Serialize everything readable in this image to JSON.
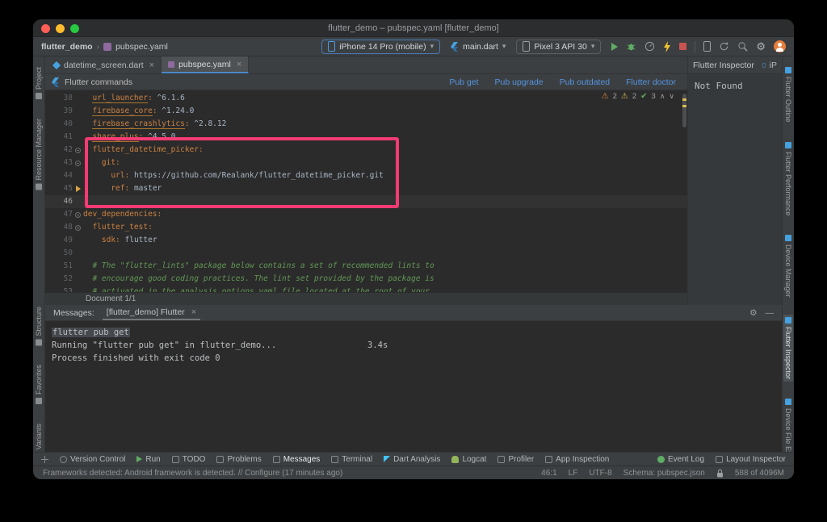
{
  "window": {
    "title": "flutter_demo – pubspec.yaml [flutter_demo]"
  },
  "nav": {
    "project": "flutter_demo",
    "file": "pubspec.yaml",
    "device": "iPhone 14 Pro (mobile)",
    "config": "main.dart",
    "target": "Pixel 3 API 30"
  },
  "tabs": [
    {
      "label": "datetime_screen.dart",
      "type": "dart",
      "active": false
    },
    {
      "label": "pubspec.yaml",
      "type": "yaml",
      "active": true
    }
  ],
  "flutter_bar": {
    "title": "Flutter commands",
    "links": [
      "Pub get",
      "Pub upgrade",
      "Pub outdated",
      "Flutter doctor"
    ]
  },
  "inspections": {
    "errors": "2",
    "warnings": "2",
    "ok": "3"
  },
  "editor": {
    "current_line": "46",
    "document_indicator": "Document 1/1",
    "lines": [
      {
        "num": "38",
        "fold": "",
        "seg": [
          [
            "  ",
            ""
          ],
          [
            "url_launcher",
            "k u"
          ],
          [
            ":",
            "k"
          ],
          [
            " ^6.1.6",
            "v"
          ]
        ]
      },
      {
        "num": "39",
        "fold": "",
        "seg": [
          [
            "  ",
            ""
          ],
          [
            "firebase_core",
            "k u"
          ],
          [
            ":",
            "k"
          ],
          [
            " ^1.24.0",
            "v"
          ]
        ]
      },
      {
        "num": "40",
        "fold": "",
        "seg": [
          [
            "  ",
            ""
          ],
          [
            "firebase_crashlytics",
            "k u"
          ],
          [
            ":",
            "k"
          ],
          [
            " ^2.8.12",
            "v"
          ]
        ]
      },
      {
        "num": "41",
        "fold": "",
        "seg": [
          [
            "  ",
            ""
          ],
          [
            "share_plus",
            "k u"
          ],
          [
            ":",
            "k"
          ],
          [
            " ^4.5.0",
            "v"
          ]
        ]
      },
      {
        "num": "42",
        "fold": "dot",
        "seg": [
          [
            "  ",
            ""
          ],
          [
            "flutter_datetime_picker:",
            "k"
          ]
        ]
      },
      {
        "num": "43",
        "fold": "dot",
        "seg": [
          [
            "    ",
            ""
          ],
          [
            "git:",
            "k"
          ]
        ]
      },
      {
        "num": "44",
        "fold": "",
        "seg": [
          [
            "      ",
            ""
          ],
          [
            "url:",
            "k"
          ],
          [
            " https://github.com/Realank/flutter_datetime_picker.git",
            "v"
          ]
        ]
      },
      {
        "num": "45",
        "fold": "arrow",
        "seg": [
          [
            "      ",
            ""
          ],
          [
            "ref:",
            "k"
          ],
          [
            " master",
            "v"
          ]
        ]
      },
      {
        "num": "46",
        "fold": "",
        "seg": []
      },
      {
        "num": "47",
        "fold": "dot",
        "seg": [
          [
            "dev_dependencies:",
            "k"
          ]
        ]
      },
      {
        "num": "48",
        "fold": "dot",
        "seg": [
          [
            "  ",
            ""
          ],
          [
            "flutter_test:",
            "k"
          ]
        ]
      },
      {
        "num": "49",
        "fold": "",
        "seg": [
          [
            "    ",
            ""
          ],
          [
            "sdk:",
            "k"
          ],
          [
            " flutter",
            "v"
          ]
        ]
      },
      {
        "num": "50",
        "fold": "",
        "seg": []
      },
      {
        "num": "51",
        "fold": "",
        "seg": [
          [
            "  ",
            ""
          ],
          [
            "# The \"flutter_lints\" package below contains a set of recommended lints to",
            "cm"
          ]
        ]
      },
      {
        "num": "52",
        "fold": "",
        "seg": [
          [
            "  ",
            ""
          ],
          [
            "# encourage good coding practices. The lint set provided by the package is",
            "cm"
          ]
        ]
      },
      {
        "num": "53",
        "fold": "",
        "seg": [
          [
            "  ",
            ""
          ],
          [
            "# activated in the analysis_options.yaml file located at the root of your",
            "cm"
          ]
        ]
      }
    ]
  },
  "annotation": {
    "color": "#f43b73"
  },
  "right_panel": {
    "title": "Flutter Inspector",
    "device": "iP",
    "content": "Not Found"
  },
  "right_strip": [
    {
      "label": "Flutter Outline",
      "active": false
    },
    {
      "label": "Flutter Performance",
      "active": false
    },
    {
      "label": "Device Manager",
      "active": false
    },
    {
      "label": "Flutter Inspector",
      "active": true
    },
    {
      "label": "Device File Explorer",
      "active": false
    }
  ],
  "left_strip": [
    {
      "label": "Project",
      "gap": 0
    },
    {
      "label": "Resource Manager",
      "gap": 0
    },
    {
      "label": "Structure",
      "gap": 120
    },
    {
      "label": "Favorites",
      "gap": 0
    },
    {
      "label": "Build Variants",
      "gap": 0
    }
  ],
  "messages": {
    "label": "Messages:",
    "tab": "[flutter_demo] Flutter",
    "close": "×",
    "line1": "flutter pub get",
    "line2": "Running \"flutter pub get\" in flutter_demo...",
    "line2_time": "3.4s",
    "line3": "Process finished with exit code 0",
    "gear": "⚙",
    "minimize": "—"
  },
  "toolbar_bottom": {
    "left": [
      {
        "label": "Version Control",
        "icon": "branch",
        "active": false
      },
      {
        "label": "Run",
        "icon": "play",
        "active": false
      },
      {
        "label": "TODO",
        "icon": "todo",
        "active": false
      },
      {
        "label": "Problems",
        "icon": "problems",
        "active": false
      },
      {
        "label": "Messages",
        "icon": "messages",
        "active": true
      },
      {
        "label": "Terminal",
        "icon": "terminal",
        "active": false
      },
      {
        "label": "Dart Analysis",
        "icon": "dart",
        "active": false
      },
      {
        "label": "Logcat",
        "icon": "logcat",
        "active": false
      },
      {
        "label": "Profiler",
        "icon": "profiler",
        "active": false
      },
      {
        "label": "App Inspection",
        "icon": "app-inspection",
        "active": false
      }
    ],
    "right": [
      {
        "label": "Event Log",
        "icon": "event-log",
        "active": false
      },
      {
        "label": "Layout Inspector",
        "icon": "layout-inspector",
        "active": false
      }
    ]
  },
  "status_bar": {
    "left": "Frameworks detected: Android framework is detected. // Configure (17 minutes ago)",
    "position": "46:1",
    "line_ending": "LF",
    "encoding": "UTF-8",
    "schema": "Schema: pubspec.json",
    "memory": "588 of 4096M"
  },
  "glyphs": {
    "chevron_down": "▾",
    "crumb_sep": "›",
    "warn": "⚠",
    "check": "✔",
    "up": "∧",
    "down": "∨",
    "gear": "⚙"
  }
}
